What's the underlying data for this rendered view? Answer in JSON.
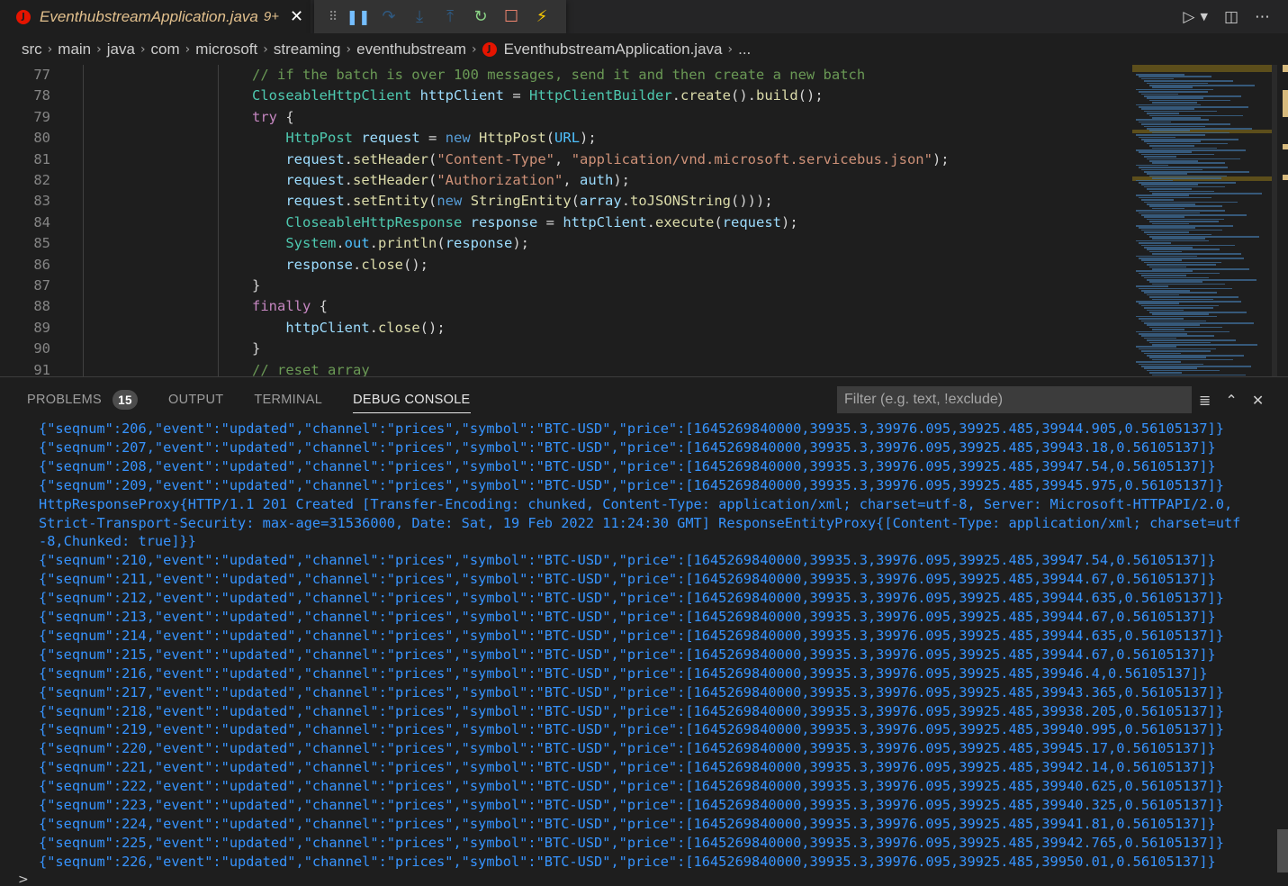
{
  "tab": {
    "title": "EventhubstreamApplication.java",
    "modified": "9+",
    "close": "✕"
  },
  "colors": {
    "accent": "#3794ff",
    "error": "#e51400",
    "modified": "#e2c08d"
  },
  "debug_toolbar": {
    "icons": [
      "drag-handle-icon",
      "pause-icon",
      "step-over-icon",
      "step-into-icon",
      "step-out-icon",
      "restart-icon",
      "stop-icon",
      "hot-code-replace-icon"
    ]
  },
  "breadcrumb": [
    "src",
    "main",
    "java",
    "com",
    "microsoft",
    "streaming",
    "eventhubstream",
    "EventhubstreamApplication.java",
    "..."
  ],
  "editor": {
    "line_numbers": [
      "77",
      "78",
      "79",
      "80",
      "81",
      "82",
      "83",
      "84",
      "85",
      "86",
      "87",
      "88",
      "89",
      "90",
      "91"
    ]
  },
  "panel": {
    "tabs": [
      "PROBLEMS",
      "OUTPUT",
      "TERMINAL",
      "DEBUG CONSOLE"
    ],
    "active_tab": "DEBUG CONSOLE",
    "problems_count": "15",
    "filter_placeholder": "Filter (e.g. text, !exclude)",
    "prompt": ">"
  },
  "console_lines": [
    "{\"seqnum\":206,\"event\":\"updated\",\"channel\":\"prices\",\"symbol\":\"BTC-USD\",\"price\":[1645269840000,39935.3,39976.095,39925.485,39944.905,0.56105137]}",
    "{\"seqnum\":207,\"event\":\"updated\",\"channel\":\"prices\",\"symbol\":\"BTC-USD\",\"price\":[1645269840000,39935.3,39976.095,39925.485,39943.18,0.56105137]}",
    "{\"seqnum\":208,\"event\":\"updated\",\"channel\":\"prices\",\"symbol\":\"BTC-USD\",\"price\":[1645269840000,39935.3,39976.095,39925.485,39947.54,0.56105137]}",
    "{\"seqnum\":209,\"event\":\"updated\",\"channel\":\"prices\",\"symbol\":\"BTC-USD\",\"price\":[1645269840000,39935.3,39976.095,39925.485,39945.975,0.56105137]}",
    "HttpResponseProxy{HTTP/1.1 201 Created [Transfer-Encoding: chunked, Content-Type: application/xml; charset=utf-8, Server: Microsoft-HTTPAPI/2.0,",
    "Strict-Transport-Security: max-age=31536000, Date: Sat, 19 Feb 2022 11:24:30 GMT] ResponseEntityProxy{[Content-Type: application/xml; charset=utf",
    "-8,Chunked: true]}}",
    "{\"seqnum\":210,\"event\":\"updated\",\"channel\":\"prices\",\"symbol\":\"BTC-USD\",\"price\":[1645269840000,39935.3,39976.095,39925.485,39947.54,0.56105137]}",
    "{\"seqnum\":211,\"event\":\"updated\",\"channel\":\"prices\",\"symbol\":\"BTC-USD\",\"price\":[1645269840000,39935.3,39976.095,39925.485,39944.67,0.56105137]}",
    "{\"seqnum\":212,\"event\":\"updated\",\"channel\":\"prices\",\"symbol\":\"BTC-USD\",\"price\":[1645269840000,39935.3,39976.095,39925.485,39944.635,0.56105137]}",
    "{\"seqnum\":213,\"event\":\"updated\",\"channel\":\"prices\",\"symbol\":\"BTC-USD\",\"price\":[1645269840000,39935.3,39976.095,39925.485,39944.67,0.56105137]}",
    "{\"seqnum\":214,\"event\":\"updated\",\"channel\":\"prices\",\"symbol\":\"BTC-USD\",\"price\":[1645269840000,39935.3,39976.095,39925.485,39944.635,0.56105137]}",
    "{\"seqnum\":215,\"event\":\"updated\",\"channel\":\"prices\",\"symbol\":\"BTC-USD\",\"price\":[1645269840000,39935.3,39976.095,39925.485,39944.67,0.56105137]}",
    "{\"seqnum\":216,\"event\":\"updated\",\"channel\":\"prices\",\"symbol\":\"BTC-USD\",\"price\":[1645269840000,39935.3,39976.095,39925.485,39946.4,0.56105137]}",
    "{\"seqnum\":217,\"event\":\"updated\",\"channel\":\"prices\",\"symbol\":\"BTC-USD\",\"price\":[1645269840000,39935.3,39976.095,39925.485,39943.365,0.56105137]}",
    "{\"seqnum\":218,\"event\":\"updated\",\"channel\":\"prices\",\"symbol\":\"BTC-USD\",\"price\":[1645269840000,39935.3,39976.095,39925.485,39938.205,0.56105137]}",
    "{\"seqnum\":219,\"event\":\"updated\",\"channel\":\"prices\",\"symbol\":\"BTC-USD\",\"price\":[1645269840000,39935.3,39976.095,39925.485,39940.995,0.56105137]}",
    "{\"seqnum\":220,\"event\":\"updated\",\"channel\":\"prices\",\"symbol\":\"BTC-USD\",\"price\":[1645269840000,39935.3,39976.095,39925.485,39945.17,0.56105137]}",
    "{\"seqnum\":221,\"event\":\"updated\",\"channel\":\"prices\",\"symbol\":\"BTC-USD\",\"price\":[1645269840000,39935.3,39976.095,39925.485,39942.14,0.56105137]}",
    "{\"seqnum\":222,\"event\":\"updated\",\"channel\":\"prices\",\"symbol\":\"BTC-USD\",\"price\":[1645269840000,39935.3,39976.095,39925.485,39940.625,0.56105137]}",
    "{\"seqnum\":223,\"event\":\"updated\",\"channel\":\"prices\",\"symbol\":\"BTC-USD\",\"price\":[1645269840000,39935.3,39976.095,39925.485,39940.325,0.56105137]}",
    "{\"seqnum\":224,\"event\":\"updated\",\"channel\":\"prices\",\"symbol\":\"BTC-USD\",\"price\":[1645269840000,39935.3,39976.095,39925.485,39941.81,0.56105137]}",
    "{\"seqnum\":225,\"event\":\"updated\",\"channel\":\"prices\",\"symbol\":\"BTC-USD\",\"price\":[1645269840000,39935.3,39976.095,39925.485,39942.765,0.56105137]}",
    "{\"seqnum\":226,\"event\":\"updated\",\"channel\":\"prices\",\"symbol\":\"BTC-USD\",\"price\":[1645269840000,39935.3,39976.095,39925.485,39950.01,0.56105137]}"
  ]
}
